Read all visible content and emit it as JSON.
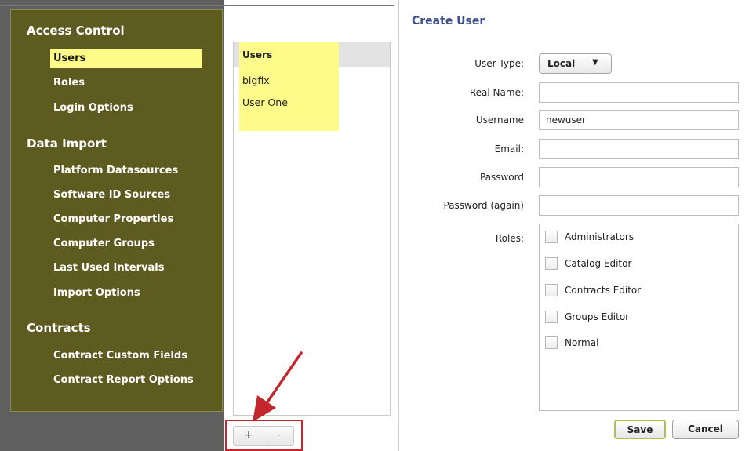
{
  "sidebar": {
    "sections": [
      {
        "title": "Access Control",
        "items": [
          "Users",
          "Roles",
          "Login Options"
        ],
        "selected": "Users"
      },
      {
        "title": "Data Import",
        "items": [
          "Platform Datasources",
          "Software ID Sources",
          "Computer Properties",
          "Computer Groups",
          "Last Used Intervals",
          "Import Options"
        ]
      },
      {
        "title": "Contracts",
        "items": [
          "Contract Custom Fields",
          "Contract Report Options"
        ]
      }
    ]
  },
  "users_list": {
    "header": "Users",
    "rows": [
      "bigfix",
      "User One"
    ],
    "add_label": "+",
    "remove_label": "-"
  },
  "form": {
    "title": "Create User",
    "user_type_label": "User Type:",
    "user_type_value": "Local",
    "real_name_label": "Real Name:",
    "real_name_value": "",
    "username_label": "Username",
    "username_value": "newuser",
    "email_label": "Email:",
    "email_value": "",
    "password_label": "Password",
    "password_value": "",
    "password_again_label": "Password (again)",
    "password_again_value": "",
    "roles_label": "Roles:",
    "roles": [
      "Administrators",
      "Catalog Editor",
      "Contracts Editor",
      "Groups Editor",
      "Normal"
    ],
    "save_label": "Save",
    "cancel_label": "Cancel"
  },
  "colors": {
    "sidebar_bg": "#5e5b20",
    "highlight": "#fdfb8a",
    "title_blue": "#3c4f8e",
    "annotation_red": "#c3262c"
  },
  "icons": {
    "annotation_arrow": "red-arrow-icon",
    "dropdown": "chevron-down-icon"
  }
}
